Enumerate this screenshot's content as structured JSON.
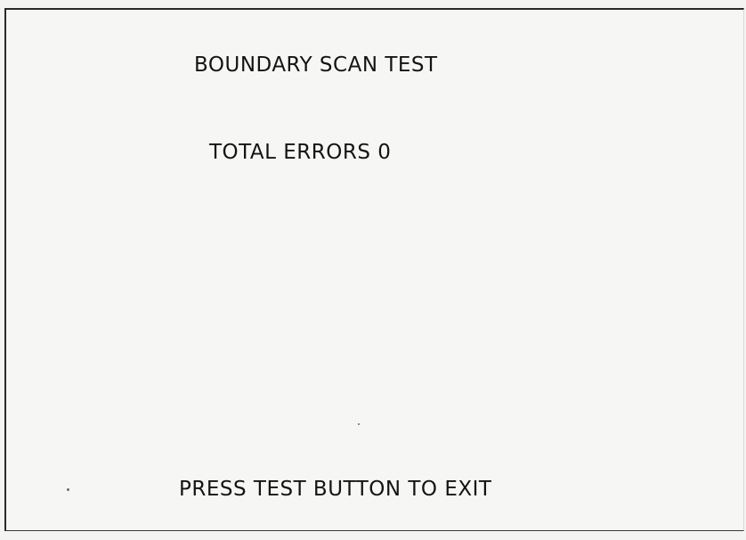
{
  "screen": {
    "title": "BOUNDARY SCAN TEST",
    "errors_text": "TOTAL ERRORS 0",
    "exit_prompt": "PRESS TEST BUTTON TO EXIT"
  }
}
